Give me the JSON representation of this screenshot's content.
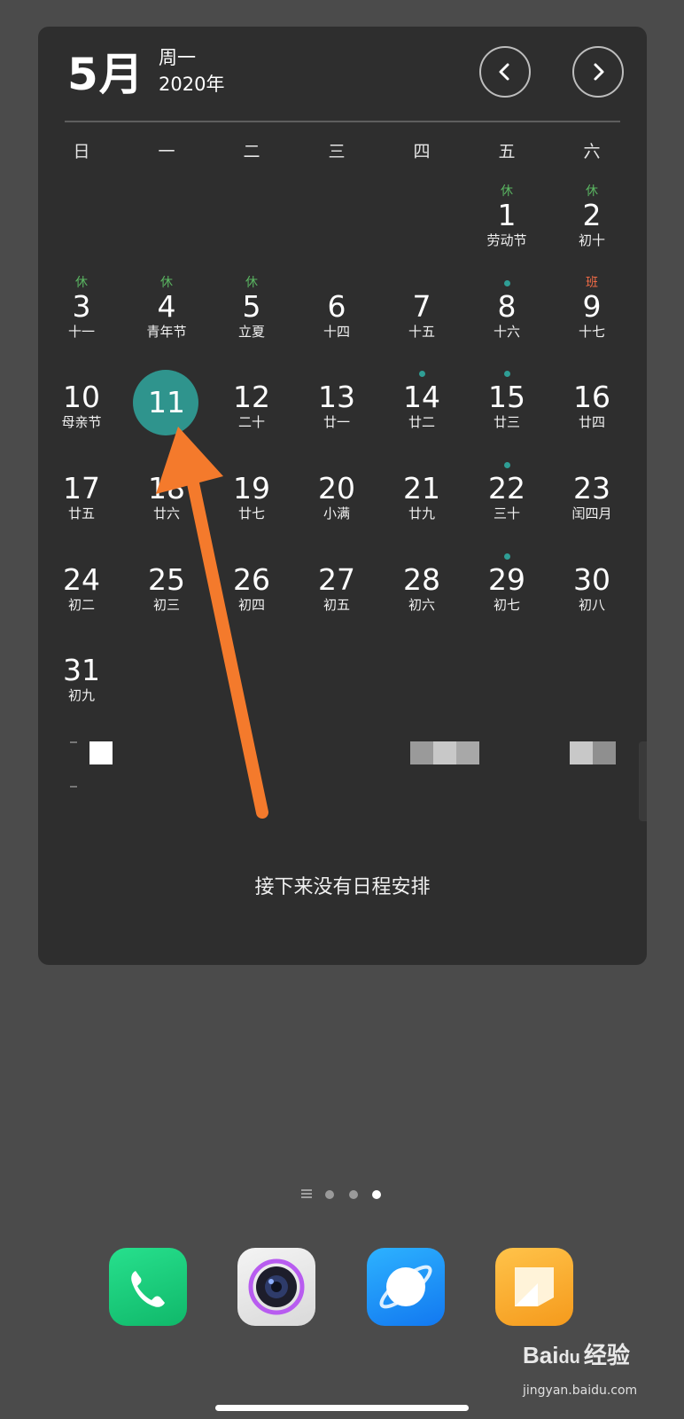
{
  "header": {
    "month": "5月",
    "weekday": "周一",
    "year": "2020年"
  },
  "weekday_labels": [
    "日",
    "一",
    "二",
    "三",
    "四",
    "五",
    "六"
  ],
  "calendar": {
    "rows": [
      [
        {
          "day": "",
          "lunar": ""
        },
        {
          "day": "",
          "lunar": ""
        },
        {
          "day": "",
          "lunar": ""
        },
        {
          "day": "",
          "lunar": ""
        },
        {
          "day": "",
          "lunar": ""
        },
        {
          "day": "1",
          "lunar": "劳动节",
          "tag": "休"
        },
        {
          "day": "2",
          "lunar": "初十",
          "tag": "休"
        }
      ],
      [
        {
          "day": "3",
          "lunar": "十一",
          "tag": "休"
        },
        {
          "day": "4",
          "lunar": "青年节",
          "tag": "休"
        },
        {
          "day": "5",
          "lunar": "立夏",
          "tag": "休"
        },
        {
          "day": "6",
          "lunar": "十四"
        },
        {
          "day": "7",
          "lunar": "十五"
        },
        {
          "day": "8",
          "lunar": "十六",
          "dot": true
        },
        {
          "day": "9",
          "lunar": "十七",
          "tag": "班",
          "work": true
        }
      ],
      [
        {
          "day": "10",
          "lunar": "母亲节"
        },
        {
          "day": "11",
          "lunar": "",
          "today": true
        },
        {
          "day": "12",
          "lunar": "二十"
        },
        {
          "day": "13",
          "lunar": "廿一"
        },
        {
          "day": "14",
          "lunar": "廿二",
          "dot": true
        },
        {
          "day": "15",
          "lunar": "廿三",
          "dot": true
        },
        {
          "day": "16",
          "lunar": "廿四"
        }
      ],
      [
        {
          "day": "17",
          "lunar": "廿五"
        },
        {
          "day": "18",
          "lunar": "廿六"
        },
        {
          "day": "19",
          "lunar": "廿七"
        },
        {
          "day": "20",
          "lunar": "小满"
        },
        {
          "day": "21",
          "lunar": "廿九"
        },
        {
          "day": "22",
          "lunar": "三十",
          "dot": true
        },
        {
          "day": "23",
          "lunar": "闰四月"
        }
      ],
      [
        {
          "day": "24",
          "lunar": "初二"
        },
        {
          "day": "25",
          "lunar": "初三"
        },
        {
          "day": "26",
          "lunar": "初四"
        },
        {
          "day": "27",
          "lunar": "初五"
        },
        {
          "day": "28",
          "lunar": "初六"
        },
        {
          "day": "29",
          "lunar": "初七",
          "dot": true
        },
        {
          "day": "30",
          "lunar": "初八"
        }
      ],
      [
        {
          "day": "31",
          "lunar": "初九"
        }
      ]
    ]
  },
  "schedule": {
    "empty_text": "接下来没有日程安排"
  },
  "page_indicator": {
    "pages": 3,
    "active": 2
  },
  "dock": {
    "apps": [
      {
        "name": "phone",
        "icon": "phone-icon"
      },
      {
        "name": "camera",
        "icon": "camera-icon"
      },
      {
        "name": "browser",
        "icon": "browser-icon"
      },
      {
        "name": "notes",
        "icon": "notes-icon"
      }
    ]
  },
  "watermark": {
    "brand_a": "Bai",
    "brand_b": "du",
    "brand_c": "经验",
    "url": "jingyan.baidu.com"
  },
  "colors": {
    "holiday": "#5ab561",
    "workday": "#ef6a45",
    "today": "#2f948d",
    "event_dot": "#2f9e95",
    "annotation_arrow": "#f47a2c"
  }
}
